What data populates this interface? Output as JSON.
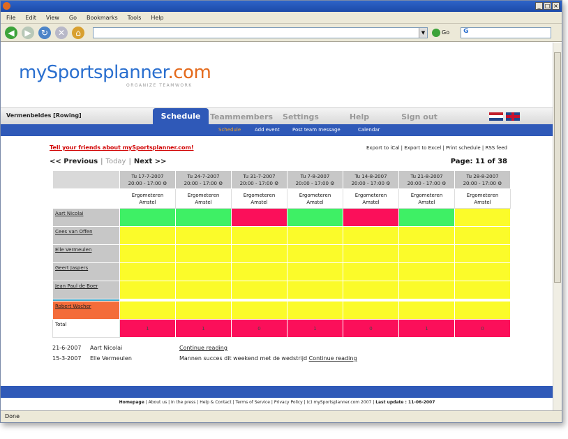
{
  "browser": {
    "menu": [
      "File",
      "Edit",
      "View",
      "Go",
      "Bookmarks",
      "Tools",
      "Help"
    ],
    "go_label": "Go",
    "search_letter": "G",
    "status": "Done"
  },
  "site": {
    "logo_my": "my",
    "logo_rest": "Sportsplanner",
    "logo_tld": ".com",
    "tagline": "ORGANIZE TEAMWORK",
    "team_name": "Vermenbeldes [Rowing]",
    "tabs": [
      "Schedule",
      "Teammembers",
      "Settings",
      "Help",
      "Sign out"
    ],
    "subnav": [
      "Schedule",
      "Add event",
      "Post team message",
      "Calendar"
    ],
    "tell_friends": "Tell your friends about mySportsplanner.com!",
    "export_links": "Export to iCal | Export to Excel | Print schedule | RSS feed",
    "pager": {
      "previous": "<< Previous",
      "today": "Today",
      "next": "Next >>",
      "page_info": "Page: 11 of 38"
    }
  },
  "schedule": {
    "dates": [
      {
        "date": "Tu 17-7-2007",
        "time": "20:00 - 17:00"
      },
      {
        "date": "Tu 24-7-2007",
        "time": "20:00 - 17:00"
      },
      {
        "date": "Tu 31-7-2007",
        "time": "20:00 - 17:00"
      },
      {
        "date": "Tu 7-8-2007",
        "time": "20:00 - 17:00"
      },
      {
        "date": "Tu 14-8-2007",
        "time": "20:00 - 17:00"
      },
      {
        "date": "Tu 21-8-2007",
        "time": "20:00 - 17:00"
      },
      {
        "date": "Tu 28-8-2007",
        "time": "20:00 - 17:00"
      }
    ],
    "event_title": "Ergometeren",
    "event_location": "Amstel",
    "members": [
      {
        "name": "Aart Nicolai",
        "status": [
          "green",
          "green",
          "red",
          "green",
          "red",
          "green",
          "yellow"
        ]
      },
      {
        "name": "Cees van Offen",
        "status": [
          "yellow",
          "yellow",
          "yellow",
          "yellow",
          "yellow",
          "yellow",
          "yellow"
        ]
      },
      {
        "name": "Elle Vermeulen",
        "status": [
          "yellow",
          "yellow",
          "yellow",
          "yellow",
          "yellow",
          "yellow",
          "yellow"
        ]
      },
      {
        "name": "Geert Jaspers",
        "status": [
          "yellow",
          "yellow",
          "yellow",
          "yellow",
          "yellow",
          "yellow",
          "yellow"
        ]
      },
      {
        "name": "Jean Paul de Boer",
        "status": [
          "yellow",
          "yellow",
          "yellow",
          "yellow",
          "yellow",
          "yellow",
          "yellow"
        ]
      },
      {
        "name": "Robert Wacher",
        "status": [
          "yellow",
          "yellow",
          "yellow",
          "yellow",
          "yellow",
          "yellow",
          "yellow"
        ]
      }
    ],
    "total_label": "Total",
    "totals": [
      "1",
      "1",
      "0",
      "1",
      "0",
      "1",
      "0"
    ],
    "colors": {
      "green": "#3ef065",
      "red": "#fb0f5a",
      "yellow": "#fbfb2a",
      "orange": "#f46c3a",
      "brand_blue": "#2f59b8"
    }
  },
  "news": [
    {
      "date": "21-6-2007",
      "who": "Aart Nicolai",
      "text": "",
      "link": "Continue reading"
    },
    {
      "date": "15-3-2007",
      "who": "Elle Vermeulen",
      "text": "Mannen succes dit weekend met de wedstrijd",
      "link": "Continue reading"
    }
  ],
  "footer": {
    "home": "Homepage",
    "links": "About us | In the press | Help & Contact | Terms of Service | Privacy Policy | (c) mySportsplanner.com 2007 |",
    "last_update_label": "Last update : 11-06-2007"
  }
}
